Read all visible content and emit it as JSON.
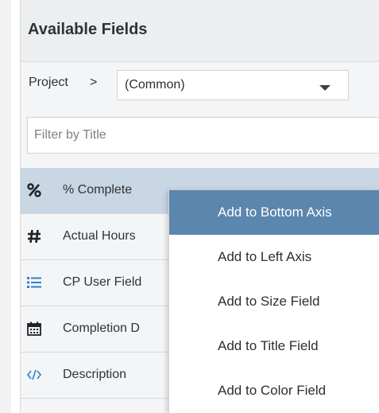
{
  "panel": {
    "title": "Available Fields"
  },
  "project": {
    "label": "Project",
    "separator": ">",
    "selected": "(Common)"
  },
  "filter": {
    "placeholder": "Filter by Title",
    "value": ""
  },
  "fields": [
    {
      "label": "% Complete",
      "icon": "percent-icon",
      "selected": true
    },
    {
      "label": "Actual Hours",
      "icon": "hash-icon",
      "selected": false
    },
    {
      "label": "CP User Field",
      "icon": "list-icon",
      "selected": false
    },
    {
      "label": "Completion D",
      "icon": "calendar-icon",
      "selected": false
    },
    {
      "label": "Description",
      "icon": "code-icon",
      "selected": false
    }
  ],
  "context_menu": {
    "items": [
      {
        "label": "Add to Bottom Axis",
        "highlighted": true
      },
      {
        "label": "Add to Left Axis",
        "highlighted": false
      },
      {
        "label": "Add to Size Field",
        "highlighted": false
      },
      {
        "label": "Add to Title Field",
        "highlighted": false
      },
      {
        "label": "Add to Color Field",
        "highlighted": false
      }
    ]
  },
  "colors": {
    "selected_row": "#c9d6e3",
    "menu_highlight": "#5b86ad",
    "list_icon": "#2e7fd1",
    "code_icon": "#2e7fd1"
  }
}
